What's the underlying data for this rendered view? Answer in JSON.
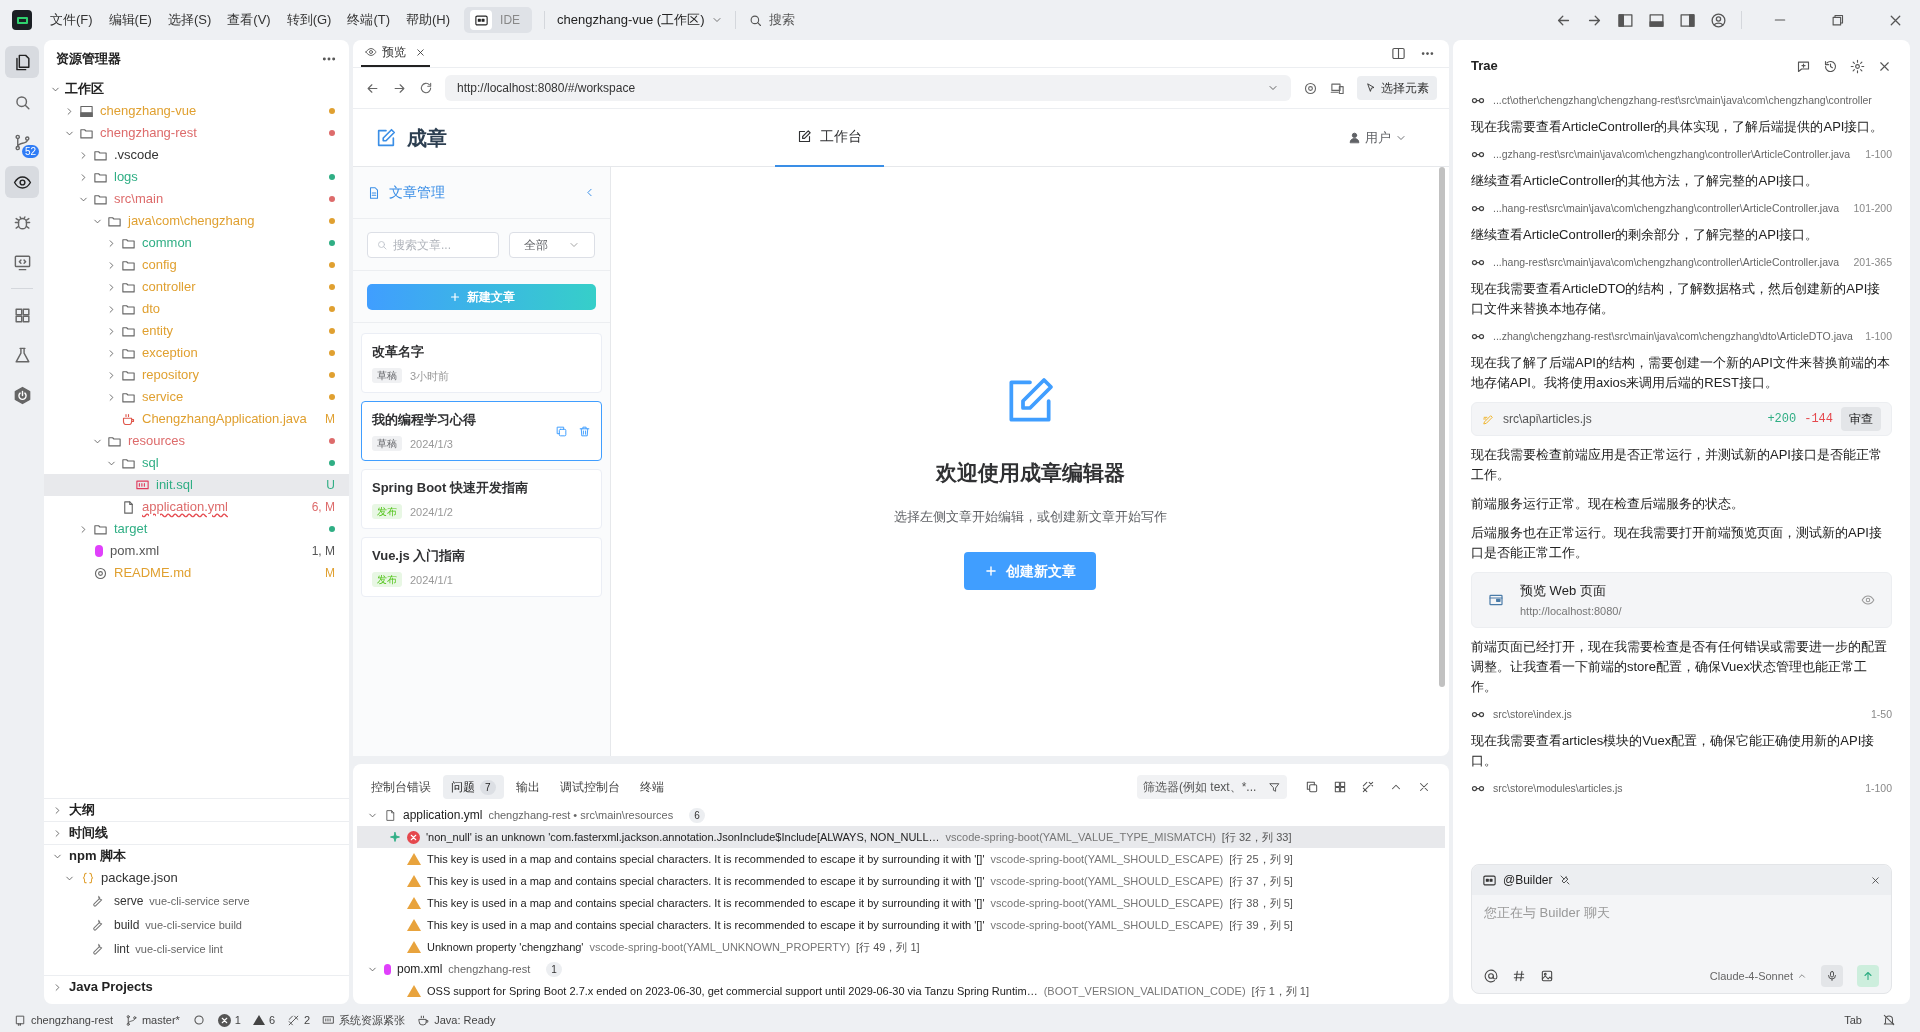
{
  "title_bar": {
    "menus": [
      "文件(F)",
      "编辑(E)",
      "选择(S)",
      "查看(V)",
      "转到(G)",
      "终端(T)",
      "帮助(H)"
    ],
    "mode": "IDE",
    "workspace": "chengzhang-vue (工作区)",
    "search": "搜索"
  },
  "activity_bar": [
    {
      "kind": "files",
      "selected": true
    },
    {
      "kind": "search",
      "selected": false
    },
    {
      "kind": "source-control",
      "selected": false,
      "badge": "52"
    },
    {
      "kind": "eye",
      "selected": true
    },
    {
      "kind": "bug",
      "selected": false
    },
    {
      "kind": "remote",
      "selected": false
    },
    {
      "kind": "divider"
    },
    {
      "kind": "extensions",
      "selected": false
    },
    {
      "kind": "flask",
      "selected": false
    },
    {
      "kind": "power",
      "selected": false
    }
  ],
  "explorer": {
    "title": "资源管理器",
    "root": "工作区",
    "tree": [
      {
        "label": "chengzhang-vue",
        "kind": "repo",
        "expanded": false,
        "color": "#e0a030"
      },
      {
        "label": "chengzhang-rest",
        "kind": "folder",
        "expanded": true,
        "color": "#dd6b6b",
        "children": [
          {
            "label": ".vscode",
            "kind": "folder",
            "expanded": false,
            "color": "#333333"
          },
          {
            "label": "logs",
            "kind": "folder",
            "expanded": false,
            "color": "#2fae84"
          },
          {
            "label": "src\\main",
            "kind": "folder",
            "expanded": true,
            "color": "#dd6b6b",
            "children": [
              {
                "label": "java\\com\\chengzhang",
                "kind": "folder",
                "expanded": true,
                "color": "#e0a030",
                "children": [
                  {
                    "label": "common",
                    "kind": "folder",
                    "expanded": false,
                    "color": "#2fae84"
                  },
                  {
                    "label": "config",
                    "kind": "folder",
                    "expanded": false,
                    "color": "#e0a030"
                  },
                  {
                    "label": "controller",
                    "kind": "folder",
                    "expanded": false,
                    "color": "#e0a030"
                  },
                  {
                    "label": "dto",
                    "kind": "folder",
                    "expanded": false,
                    "color": "#e0a030"
                  },
                  {
                    "label": "entity",
                    "kind": "folder",
                    "expanded": false,
                    "color": "#e0a030"
                  },
                  {
                    "label": "exception",
                    "kind": "folder",
                    "expanded": false,
                    "color": "#e0a030"
                  },
                  {
                    "label": "repository",
                    "kind": "folder",
                    "expanded": false,
                    "color": "#e0a030"
                  },
                  {
                    "label": "service",
                    "kind": "folder",
                    "expanded": false,
                    "color": "#e0a030"
                  },
                  {
                    "label": "ChengzhangApplication.java",
                    "kind": "java",
                    "color": "#e0a030",
                    "badge": "M"
                  }
                ]
              },
              {
                "label": "resources",
                "kind": "folder",
                "expanded": true,
                "color": "#dd6b6b",
                "children": [
                  {
                    "label": "sql",
                    "kind": "folder",
                    "expanded": true,
                    "color": "#2fae84",
                    "children": [
                      {
                        "label": "init.sql",
                        "kind": "sql",
                        "color": "#2fae84",
                        "badge": "U",
                        "selected": true
                      }
                    ]
                  },
                  {
                    "label": "application.yml",
                    "kind": "file",
                    "color": "#dd6b6b",
                    "badge": "6, M",
                    "error": true
                  }
                ]
              }
            ]
          },
          {
            "label": "target",
            "kind": "folder",
            "expanded": false,
            "color": "#2fae84"
          },
          {
            "label": "pom.xml",
            "kind": "xml",
            "color": "#555555",
            "badge": "1, M"
          },
          {
            "label": "README.md",
            "kind": "info",
            "color": "#e0a030",
            "badge": "M"
          }
        ]
      }
    ],
    "sections": [
      {
        "title": "大纲",
        "expanded": false
      },
      {
        "title": "时间线",
        "expanded": false
      },
      {
        "title": "npm 脚本",
        "expanded": true,
        "package": "package.json",
        "scripts": [
          {
            "name": "serve",
            "command": "vue-cli-service serve"
          },
          {
            "name": "build",
            "command": "vue-cli-service build"
          },
          {
            "name": "lint",
            "command": "vue-cli-service lint"
          }
        ]
      },
      {
        "title": "Java Projects",
        "expanded": false
      }
    ]
  },
  "preview": {
    "tab": "预览",
    "url": "http://localhost:8080/#/workspace",
    "pick_button": "选择元素",
    "app": {
      "brand": "成章",
      "nav": [
        {
          "label": "工作台",
          "selected": true
        }
      ],
      "user": "用户",
      "sidebar": {
        "title": "文章管理",
        "search_placeholder": "搜索文章...",
        "filter": "全部",
        "new_button": "新建文章",
        "articles": [
          {
            "title": "改革名字",
            "status": "草稿",
            "kind": "draft",
            "date": "3小时前",
            "selected": false
          },
          {
            "title": "我的编程学习心得",
            "status": "草稿",
            "kind": "draft",
            "date": "2024/1/3",
            "selected": true
          },
          {
            "title": "Spring Boot 快速开发指南",
            "status": "发布",
            "kind": "published",
            "date": "2024/1/2",
            "selected": false
          },
          {
            "title": "Vue.js 入门指南",
            "status": "发布",
            "kind": "published",
            "date": "2024/1/1",
            "selected": false
          }
        ]
      },
      "empty_state": {
        "title": "欢迎使用成章编辑器",
        "subtitle": "选择左侧文章开始编辑，或创建新文章开始写作",
        "button": "创建新文章"
      }
    }
  },
  "panel": {
    "tabs": [
      {
        "label": "控制台错误",
        "selected": false
      },
      {
        "label": "问题",
        "selected": true,
        "count": "7"
      },
      {
        "label": "输出",
        "selected": false
      },
      {
        "label": "调试控制台",
        "selected": false
      },
      {
        "label": "终端",
        "selected": false
      }
    ],
    "filter_placeholder": "筛选器(例如 text、*...",
    "problems": [
      {
        "file": "application.yml",
        "kind": "file",
        "path": "chengzhang-rest • src\\main\\resources",
        "count": "6",
        "expanded": true,
        "items": [
          {
            "kind": "error",
            "message": "'non_null' is an unknown 'com.fasterxml.jackson.annotation.JsonInclude$Include[ALWAYS, NON_NULL…",
            "source": "vscode-spring-boot(YAML_VALUE_TYPE_MISMATCH)",
            "location": "[行 32，列 33]",
            "selected": true,
            "ai_fix": true
          },
          {
            "kind": "warning",
            "message": "This key is used in a map and contains special characters. It is recommended to escape it by surrounding it with '[]'",
            "source": "vscode-spring-boot(YAML_SHOULD_ESCAPE)",
            "location": "[行 25，列 9]",
            "selected": false
          },
          {
            "kind": "warning",
            "message": "This key is used in a map and contains special characters. It is recommended to escape it by surrounding it with '[]'",
            "source": "vscode-spring-boot(YAML_SHOULD_ESCAPE)",
            "location": "[行 37，列 5]",
            "selected": false
          },
          {
            "kind": "warning",
            "message": "This key is used in a map and contains special characters. It is recommended to escape it by surrounding it with '[]'",
            "source": "vscode-spring-boot(YAML_SHOULD_ESCAPE)",
            "location": "[行 38，列 5]",
            "selected": false
          },
          {
            "kind": "warning",
            "message": "This key is used in a map and contains special characters. It is recommended to escape it by surrounding it with '[]'",
            "source": "vscode-spring-boot(YAML_SHOULD_ESCAPE)",
            "location": "[行 39，列 5]",
            "selected": false
          },
          {
            "kind": "warning",
            "message": "Unknown property 'chengzhang'",
            "source": "vscode-spring-boot(YAML_UNKNOWN_PROPERTY)",
            "location": "[行 49，列 1]",
            "selected": false
          }
        ]
      },
      {
        "file": "pom.xml",
        "kind": "xml",
        "path": "chengzhang-rest",
        "count": "1",
        "expanded": true,
        "items": [
          {
            "kind": "warning",
            "message": "OSS support for Spring Boot 2.7.x ended on 2023-06-30, get commercial support until 2029-06-30 via Tanzu Spring Runtim…",
            "source": "(BOOT_VERSION_VALIDATION_CODE)",
            "location": "[行 1，列 1]",
            "selected": false
          }
        ]
      }
    ]
  },
  "assistant": {
    "title": "Trae",
    "messages": [
      {
        "kind": "ref",
        "path": "...ct\\other\\chengzhang\\chengzhang-rest\\src\\main\\java\\com\\chengzhang\\controller"
      },
      {
        "kind": "text",
        "text": "现在我需要查看ArticleController的具体实现，了解后端提供的API接口。"
      },
      {
        "kind": "ref",
        "path": "...gzhang-rest\\src\\main\\java\\com\\chengzhang\\controller\\ArticleController.java",
        "range": "1-100"
      },
      {
        "kind": "text",
        "text": "继续查看ArticleController的其他方法，了解完整的API接口。"
      },
      {
        "kind": "ref",
        "path": "...hang-rest\\src\\main\\java\\com\\chengzhang\\controller\\ArticleController.java",
        "range": "101-200"
      },
      {
        "kind": "text",
        "text": "继续查看ArticleController的剩余部分，了解完整的API接口。"
      },
      {
        "kind": "ref",
        "path": "...hang-rest\\src\\main\\java\\com\\chengzhang\\controller\\ArticleController.java",
        "range": "201-365"
      },
      {
        "kind": "text",
        "text": "现在我需要查看ArticleDTO的结构，了解数据格式，然后创建新的API接口文件来替换本地存储。"
      },
      {
        "kind": "ref",
        "path": "...zhang\\chengzhang-rest\\src\\main\\java\\com\\chengzhang\\dto\\ArticleDTO.java",
        "range": "1-100"
      },
      {
        "kind": "text",
        "text": "现在我了解了后端API的结构，需要创建一个新的API文件来替换前端的本地存储API。我将使用axios来调用后端的REST接口。"
      },
      {
        "kind": "diff",
        "path": "src\\api\\articles.js",
        "added": "+200",
        "removed": "-144",
        "action": "审查"
      },
      {
        "kind": "text",
        "text": "现在我需要检查前端应用是否正常运行，并测试新的API接口是否能正常工作。"
      },
      {
        "kind": "text",
        "text": "前端服务运行正常。现在检查后端服务的状态。"
      },
      {
        "kind": "text",
        "text": "后端服务也在正常运行。现在我需要打开前端预览页面，测试新的API接口是否能正常工作。"
      },
      {
        "kind": "preview",
        "title": "预览 Web 页面",
        "url": "http://localhost:8080/"
      },
      {
        "kind": "text",
        "text": "前端页面已经打开，现在我需要检查是否有任何错误或需要进一步的配置调整。让我查看一下前端的store配置，确保Vuex状态管理也能正常工作。"
      },
      {
        "kind": "ref",
        "path": "src\\store\\index.js",
        "range": "1-50"
      },
      {
        "kind": "text",
        "text": "现在我需要查看articles模块的Vuex配置，确保它能正确使用新的API接口。"
      },
      {
        "kind": "ref",
        "path": "src\\store\\modules\\articles.js",
        "range": "1-100"
      }
    ],
    "composer": {
      "agent": "@Builder",
      "placeholder": "您正在与 Builder 聊天",
      "model": "Claude-4-Sonnet"
    }
  },
  "status_bar": {
    "left": [
      {
        "kind": "repo",
        "text": "chengzhang-rest"
      },
      {
        "kind": "branch",
        "text": "master*"
      },
      {
        "kind": "sync"
      },
      {
        "kind": "errors",
        "text": "1"
      },
      {
        "kind": "warnings",
        "text": "6"
      },
      {
        "kind": "tools",
        "text": "2"
      },
      {
        "kind": "resources",
        "text": "系统资源紧张"
      },
      {
        "kind": "java",
        "text": "Java: Ready"
      }
    ],
    "right": [
      {
        "kind": "text",
        "text": "Tab"
      },
      {
        "kind": "bell"
      }
    ]
  }
}
